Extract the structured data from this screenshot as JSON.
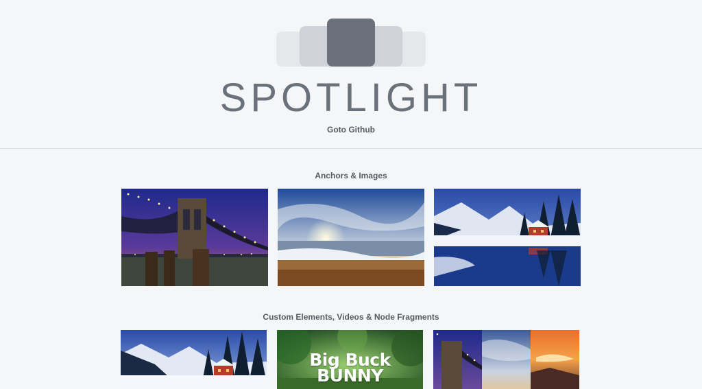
{
  "header": {
    "title": "SPOTLIGHT",
    "github_link": "Goto Github"
  },
  "sections": [
    {
      "title": "Anchors & Images",
      "items": [
        {
          "subject": "night bridge"
        },
        {
          "subject": "ocean sunset"
        },
        {
          "subject": "snow cabin lake"
        }
      ]
    },
    {
      "title": "Custom Elements, Videos & Node Fragments",
      "items": [
        {
          "subject": "snow cabin"
        },
        {
          "subject": "Big Buck Bunny video",
          "overlay_line1": "Big Buck",
          "overlay_line2": "BUNNY"
        },
        {
          "subject": "image fragment collage"
        }
      ]
    }
  ],
  "colors": {
    "background": "#f5f6f8",
    "logo_dark": "#6b717a",
    "logo_mid": "#cfd3d9",
    "logo_light": "#e5e7eb",
    "text": "#555b63"
  }
}
